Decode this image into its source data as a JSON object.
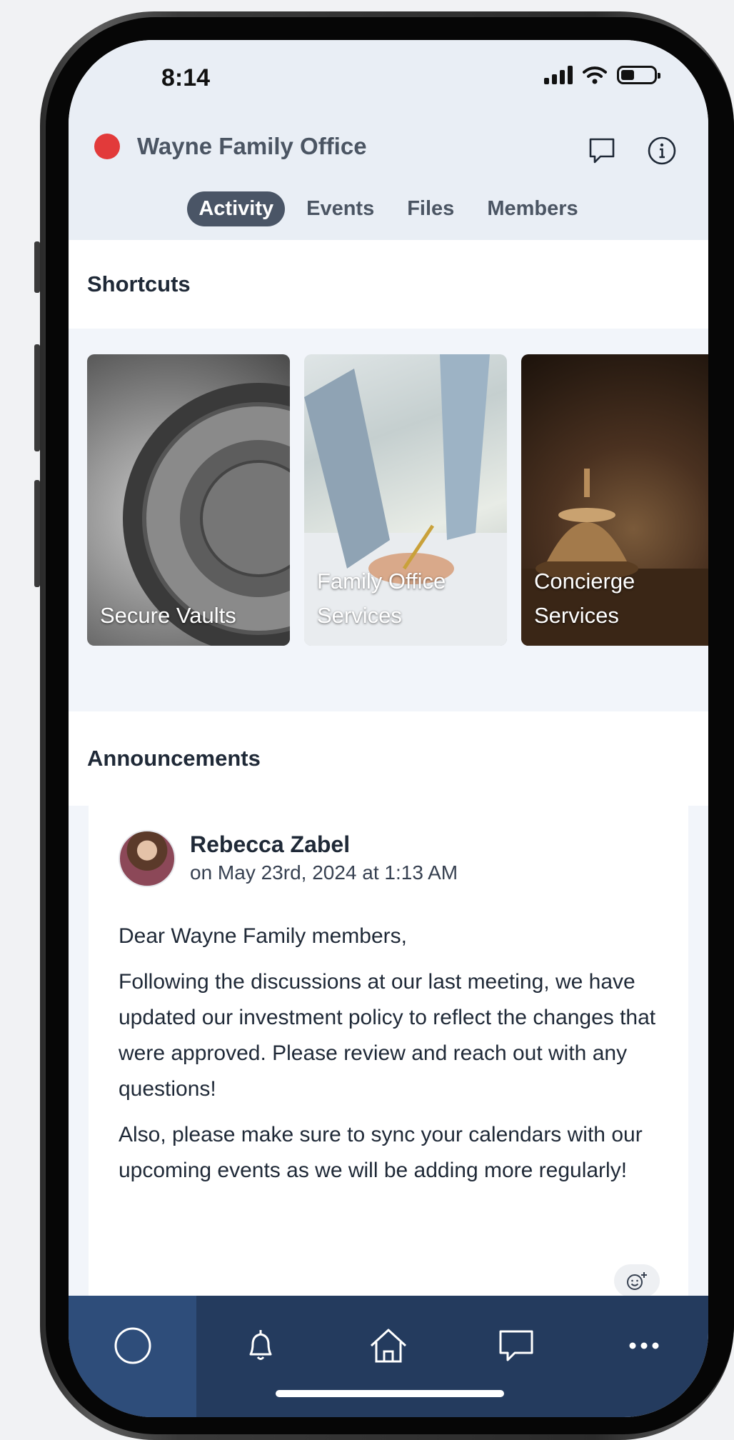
{
  "status_bar": {
    "time": "8:14"
  },
  "header": {
    "title": "Wayne Family Office",
    "tabs": [
      {
        "label": "Activity",
        "active": true
      },
      {
        "label": "Events",
        "active": false
      },
      {
        "label": "Files",
        "active": false
      },
      {
        "label": "Members",
        "active": false
      }
    ]
  },
  "shortcuts": {
    "heading": "Shortcuts",
    "cards": [
      {
        "label": "Secure Vaults"
      },
      {
        "label": "Family Office Services"
      },
      {
        "label": "Concierge Services"
      }
    ]
  },
  "announcements": {
    "heading": "Announcements",
    "post": {
      "author": "Rebecca Zabel",
      "date": "on May 23rd, 2024 at 1:13 AM",
      "greeting": "Dear Wayne Family members,",
      "paragraph1": "Following the discussions at our last meeting, we have updated our investment policy to reflect the changes that were approved. Please review and reach out with any questions!",
      "paragraph2": "Also, please make sure to sync your calendars with our upcoming events as we will be adding more regularly!"
    }
  },
  "bottom_nav": {
    "items": [
      {
        "icon": "circle-icon",
        "active": true
      },
      {
        "icon": "bell-icon",
        "active": false
      },
      {
        "icon": "home-icon",
        "active": false
      },
      {
        "icon": "chat-icon",
        "active": false
      },
      {
        "icon": "more-icon",
        "active": false
      }
    ]
  },
  "colors": {
    "status_dot": "#e23a3a",
    "nav_background": "#243b5e",
    "nav_active": "#2e4d7a",
    "tab_active": "#4a5566"
  }
}
